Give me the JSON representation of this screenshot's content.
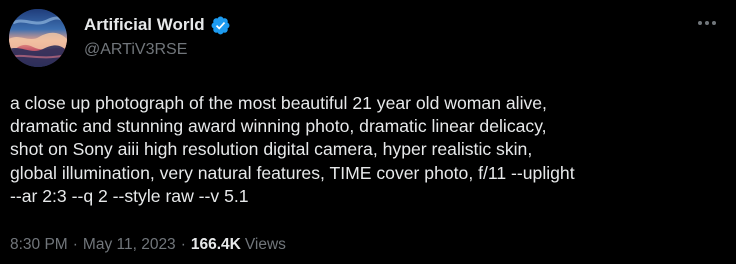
{
  "author": {
    "display_name": "Artificial World",
    "handle": "@ARTiV3RSE",
    "verified": true
  },
  "tweet": {
    "lines": [
      "a close up photograph of the most beautiful 21 year old woman alive,",
      "dramatic and stunning award winning photo, dramatic linear delicacy,",
      "shot on Sony aiii high resolution digital camera, hyper realistic skin,",
      "global illumination, very natural features, TIME cover photo, f/11 --uplight",
      "--ar 2:3 --q 2 --style raw --v 5.1"
    ]
  },
  "meta": {
    "time": "8:30 PM",
    "separator": "·",
    "date": "May 11, 2023",
    "views_count": "166.4K",
    "views_label": "Views"
  },
  "icons": {
    "verified": "verified-badge-icon",
    "more": "more-horizontal-icon"
  },
  "colors": {
    "background": "#000000",
    "primary_text": "#e7e9ea",
    "secondary_text": "#71767b",
    "verified_blue": "#1d9bf0"
  }
}
